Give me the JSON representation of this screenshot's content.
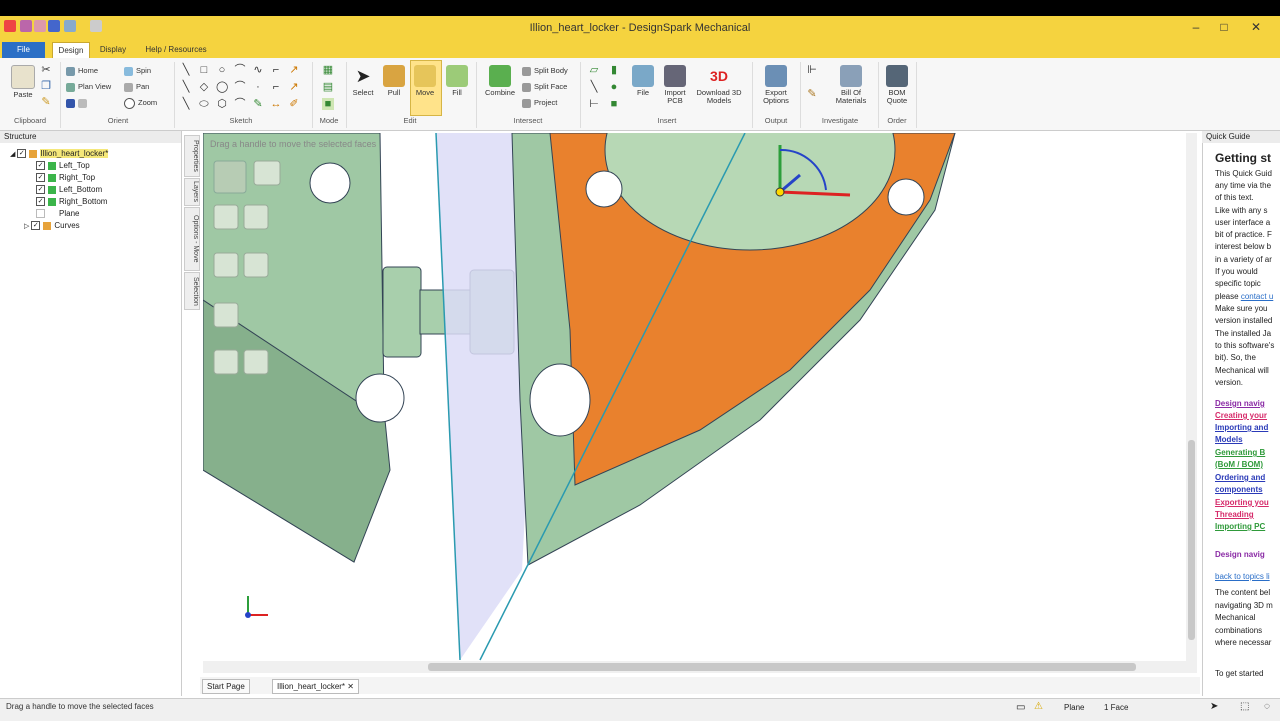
{
  "app": {
    "title": "Illion_heart_locker - DesignSpark Mechanical"
  },
  "tabs": [
    "File",
    "Design",
    "Display",
    "Help / Resources"
  ],
  "ribbon": {
    "clipboard": {
      "paste": "Paste",
      "group": "Clipboard"
    },
    "orient": {
      "home": "Home",
      "spin": "Spin",
      "plan_view": "Plan View",
      "pan": "Pan",
      "zoom": "Zoom",
      "group": "Orient"
    },
    "sketch": {
      "group": "Sketch"
    },
    "mode": {
      "group": "Mode"
    },
    "edit": {
      "select": "Select",
      "pull": "Pull",
      "move": "Move",
      "fill": "Fill",
      "group": "Edit"
    },
    "intersect": {
      "combine": "Combine",
      "split_body": "Split Body",
      "split_face": "Split Face",
      "project": "Project",
      "group": "Intersect"
    },
    "insert": {
      "file": "File",
      "import_pcb": "Import PCB",
      "download": "Download 3D Models",
      "group": "Insert"
    },
    "output": {
      "export": "Export Options",
      "group": "Output"
    },
    "investigate": {
      "bom": "Bill Of Materials",
      "group": "Investigate"
    },
    "order": {
      "bom_quote": "BOM Quote",
      "group": "Order"
    }
  },
  "structure": {
    "header": "Structure",
    "root": "Illion_heart_locker*",
    "items": [
      "Left_Top",
      "Right_Top",
      "Left_Bottom",
      "Right_Bottom",
      "Plane",
      "Curves"
    ]
  },
  "side_tabs": [
    "Properties",
    "Layers",
    "Options - Move",
    "Selection"
  ],
  "viewport": {
    "hint": "Drag a handle to move the selected faces"
  },
  "doc_tabs": [
    "Start Page",
    "Illion_heart_locker*"
  ],
  "quick_guide": {
    "header": "Quick Guide",
    "title": "Getting st",
    "intro": [
      "This Quick Guid",
      "any time via the",
      "of this text.",
      "Like with any s",
      "user interface a",
      "bit of practice. F",
      "interest below b",
      "in a variety of ar",
      "If   you   would",
      "specific   topic",
      "please",
      "Make sure you",
      "version installed",
      "The installed Ja",
      "to this software's",
      "bit).  So,  the",
      "Mechanical will",
      "version."
    ],
    "contact_link": "contact u",
    "links": [
      "Design navig",
      "Creating your",
      "Importing and",
      "Models",
      "Generating B",
      "(BoM / BOM)",
      "Ordering and",
      "components",
      "Exporting you",
      "Threading",
      "Importing PC"
    ],
    "section_title": "Design navig",
    "back_link": "back to topics li",
    "body": [
      "The content bel",
      "navigating 3D m",
      "Mechanical",
      "combinations",
      "where necessar"
    ],
    "footer": "To  get  started"
  },
  "status": {
    "text": "Drag a handle to move the selected faces",
    "plane": "Plane",
    "faces": "1 Face"
  },
  "colors": {
    "accent_yellow": "#f5d33f",
    "body_green": "#9fc8a4",
    "highlight_orange": "#e9812d",
    "file_tab_blue": "#2b6fc6"
  }
}
